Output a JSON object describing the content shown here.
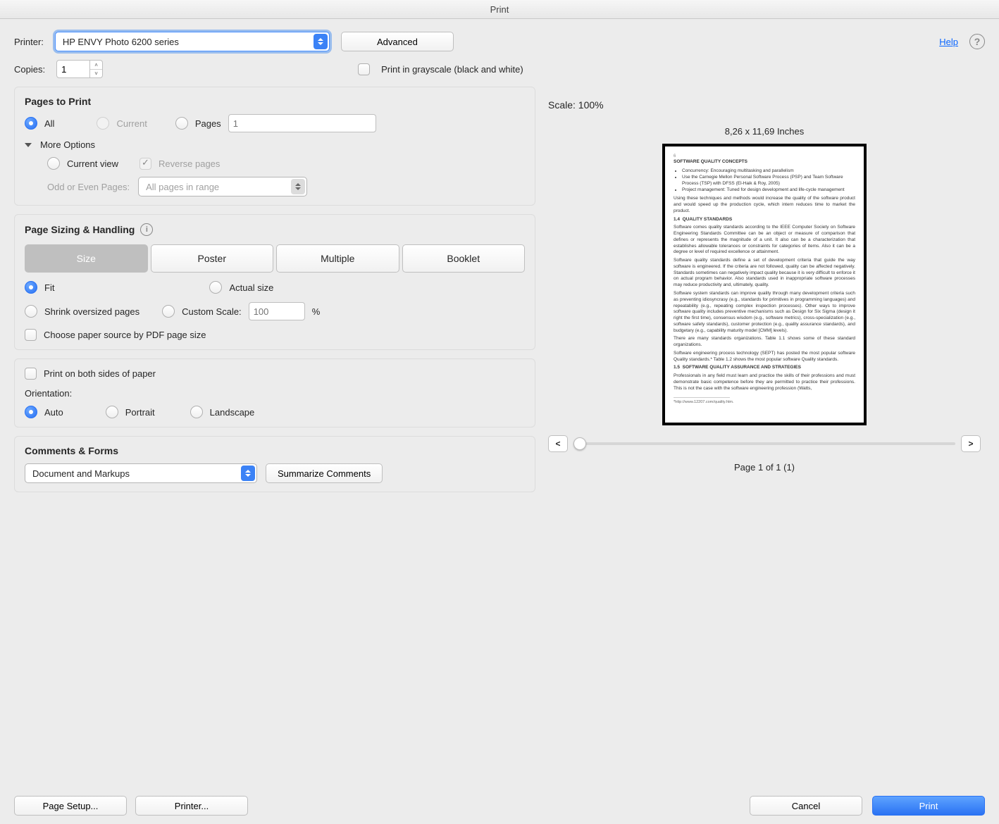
{
  "window": {
    "title": "Print"
  },
  "top": {
    "printer_label": "Printer:",
    "printer_value": "HP ENVY Photo 6200 series",
    "advanced": "Advanced",
    "help": "Help",
    "copies_label": "Copies:",
    "copies_value": "1",
    "grayscale_label": "Print in grayscale (black and white)"
  },
  "pages": {
    "heading": "Pages to Print",
    "all": "All",
    "current": "Current",
    "pages_label": "Pages",
    "pages_placeholder": "1",
    "more_options": "More Options",
    "current_view": "Current view",
    "reverse_pages": "Reverse pages",
    "odd_even_label": "Odd or Even Pages:",
    "odd_even_value": "All pages in range"
  },
  "sizing": {
    "heading": "Page Sizing & Handling",
    "tabs": [
      "Size",
      "Poster",
      "Multiple",
      "Booklet"
    ],
    "fit": "Fit",
    "actual_size": "Actual size",
    "shrink": "Shrink oversized pages",
    "custom_scale": "Custom Scale:",
    "custom_scale_value": "100",
    "percent": "%",
    "choose_source": "Choose paper source by PDF page size"
  },
  "duplex": {
    "both_sides": "Print on both sides of paper",
    "orientation_label": "Orientation:",
    "auto": "Auto",
    "portrait": "Portrait",
    "landscape": "Landscape"
  },
  "comments": {
    "heading": "Comments & Forms",
    "value": "Document and Markups",
    "summarize": "Summarize Comments"
  },
  "preview": {
    "scale_label": "Scale: 100%",
    "dims": "8,26 x 11,69 Inches",
    "page_of": "Page 1 of 1 (1)",
    "prev": "<",
    "next": ">"
  },
  "footer": {
    "page_setup": "Page Setup...",
    "printer": "Printer...",
    "cancel": "Cancel",
    "print": "Print"
  }
}
